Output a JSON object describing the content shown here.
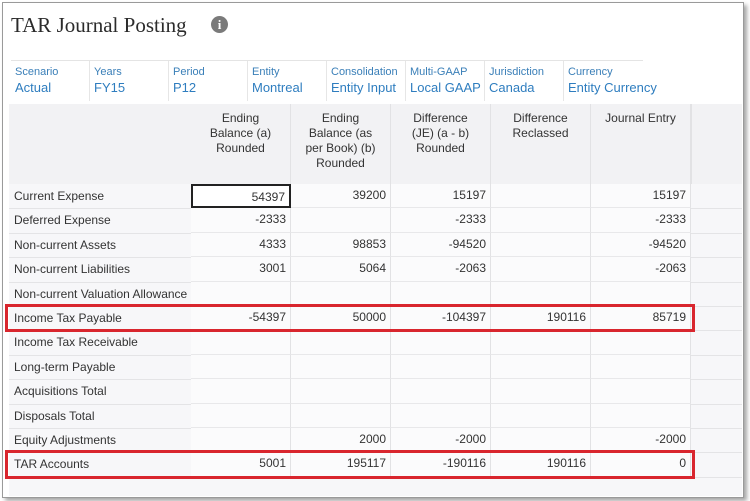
{
  "header": {
    "title": "TAR Journal Posting"
  },
  "pov": [
    {
      "dimension": "Scenario",
      "member": "Actual"
    },
    {
      "dimension": "Years",
      "member": "FY15"
    },
    {
      "dimension": "Period",
      "member": "P12"
    },
    {
      "dimension": "Entity",
      "member": "Montreal"
    },
    {
      "dimension": "Consolidation",
      "member": "Entity Input"
    },
    {
      "dimension": "Multi-GAAP",
      "member": "Local GAAP"
    },
    {
      "dimension": "Jurisdiction",
      "member": "Canada"
    },
    {
      "dimension": "Currency",
      "member": "Entity Currency"
    }
  ],
  "grid": {
    "columns": [
      "Ending\nBalance (a)\nRounded",
      "Ending\nBalance (as\nper Book) (b)\nRounded",
      "Difference\n(JE) (a - b)\nRounded",
      "Difference\nReclassed",
      "Journal Entry"
    ],
    "rows": [
      {
        "label": "Current Expense",
        "values": [
          "54397",
          "39200",
          "15197",
          "",
          "15197"
        ]
      },
      {
        "label": "Deferred Expense",
        "values": [
          "-2333",
          "",
          "-2333",
          "",
          "-2333"
        ]
      },
      {
        "label": "Non-current Assets",
        "values": [
          "4333",
          "98853",
          "-94520",
          "",
          "-94520"
        ]
      },
      {
        "label": "Non-current Liabilities",
        "values": [
          "3001",
          "5064",
          "-2063",
          "",
          "-2063"
        ]
      },
      {
        "label": "Non-current Valuation Allowance",
        "values": [
          "",
          "",
          "",
          "",
          ""
        ]
      },
      {
        "label": "Income Tax Payable",
        "values": [
          "-54397",
          "50000",
          "-104397",
          "190116",
          "85719"
        ]
      },
      {
        "label": "Income Tax Receivable",
        "values": [
          "",
          "",
          "",
          "",
          ""
        ]
      },
      {
        "label": "Long-term Payable",
        "values": [
          "",
          "",
          "",
          "",
          ""
        ]
      },
      {
        "label": "Acquisitions Total",
        "values": [
          "",
          "",
          "",
          "",
          ""
        ]
      },
      {
        "label": "Disposals Total",
        "values": [
          "",
          "",
          "",
          "",
          ""
        ]
      },
      {
        "label": "Equity Adjustments",
        "values": [
          "",
          "2000",
          "-2000",
          "",
          "-2000"
        ]
      },
      {
        "label": "TAR Accounts",
        "values": [
          "5001",
          "195117",
          "-190116",
          "190116",
          "0"
        ]
      }
    ]
  },
  "colors": {
    "highlight": "#d9262e",
    "link": "#2e7dbf"
  },
  "icons": {
    "info": "info-icon"
  }
}
